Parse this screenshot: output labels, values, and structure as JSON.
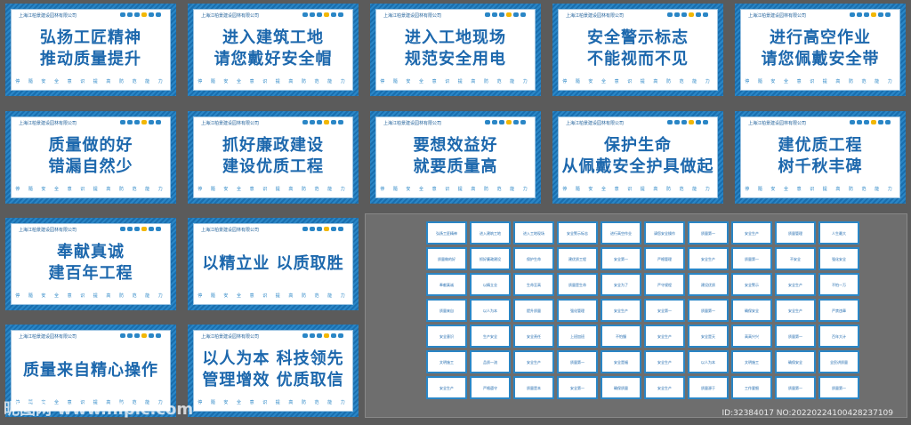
{
  "company": "上海江柏景建设园林有限公司",
  "slogan": "停 隨 安 全 意 识 提 高 防 范 能 力",
  "signs": [
    {
      "l1": "弘扬工匠精神",
      "l2": "推动质量提升"
    },
    {
      "l1": "进入建筑工地",
      "l2": "请您戴好安全帽"
    },
    {
      "l1": "进入工地现场",
      "l2": "规范安全用电"
    },
    {
      "l1": "安全警示标志",
      "l2": "不能视而不见"
    },
    {
      "l1": "进行高空作业",
      "l2": "请您佩戴安全带"
    },
    {
      "l1": "质量做的好",
      "l2": "错漏自然少"
    },
    {
      "l1": "抓好廉政建设",
      "l2": "建设优质工程"
    },
    {
      "l1": "要想效益好",
      "l2": "就要质量高"
    },
    {
      "l1": "保护生命",
      "l2": "从佩戴安全护具做起"
    },
    {
      "l1": "建优质工程",
      "l2": "树千秋丰碑"
    },
    {
      "l1": "奉献真诚",
      "l2": "建百年工程"
    },
    {
      "l1": "以精立业  以质取胜",
      "l2": ""
    },
    {
      "l1": "质量来自精心操作",
      "l2": ""
    },
    {
      "l1": "以人为本  科技领先",
      "l2": "管理增效  优质取信"
    }
  ],
  "thumbs": [
    "弘扬工匠精神",
    "进入建筑工地",
    "进入工地现场",
    "安全警示标志",
    "进行高空作业",
    "请您安全操作",
    "质量第一",
    "安全生产",
    "质量管理",
    "人生最大",
    "质量做的好",
    "抓好廉政建设",
    "保护生命",
    "建优质工程",
    "安全第一",
    "严格管理",
    "安全生产",
    "质量第一",
    "不安全",
    "强化安全",
    "奉献真诚",
    "以精立业",
    "生命至高",
    "质量是生命",
    "安全为了",
    "严守规程",
    "建设优质",
    "安全警示",
    "安全生产",
    "不怕一万",
    "质量来自",
    "以人为本",
    "提升质量",
    "强化管理",
    "安全生产",
    "安全第一",
    "质量第一",
    "确保安全",
    "安全生产",
    "严禁违章",
    "安全意识",
    "生产安全",
    "安全责任",
    "上班加班",
    "不怕慢",
    "安全生产",
    "安全是天",
    "高高兴兴",
    "质量第一",
    "百年大计",
    "文明施工",
    "品质一流",
    "安全生产",
    "质量第一",
    "安全是福",
    "安全生产",
    "以人为本",
    "文明施工",
    "确保安全",
    "全民讲质量",
    "安全生产",
    "严格遵守",
    "质量是本",
    "安全第一",
    "确保质量",
    "安全生产",
    "质量源于",
    "工作要细",
    "质量第一",
    "质量第一"
  ],
  "watermark_left": "昵图网 www.nipic.com",
  "watermark_right": "ID:32384017 NO:20220224100428237109"
}
